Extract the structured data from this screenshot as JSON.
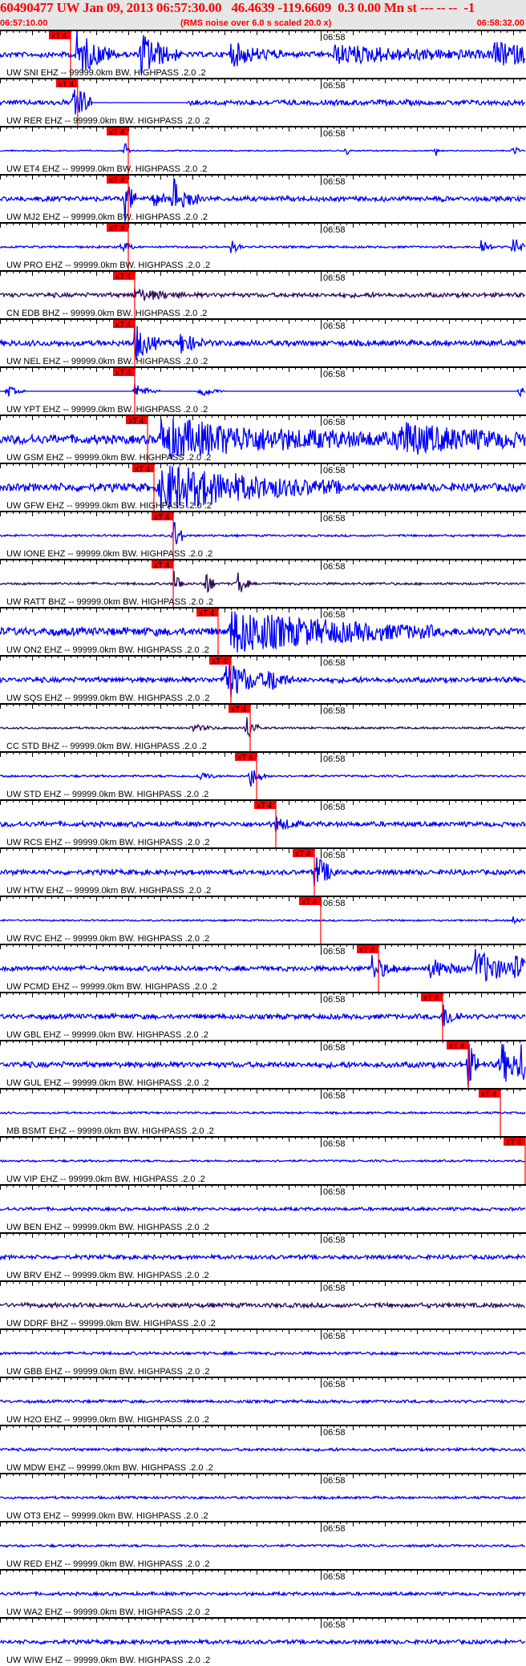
{
  "header": {
    "title": "60490477 UW Jan 09, 2013 06:57:30.00   46.4639 -119.6609  0.3 0.00 Mn st --- -- --  -1",
    "start_time": "06:57:10.00",
    "note": "(RMS noise over 6.0 s scaled 20.0 x)",
    "end_time": "06:58:32.00"
  },
  "axis": {
    "minute_label": "06:58",
    "minute_seconds": 50,
    "span_seconds": 82
  },
  "pick_label": "xT 4",
  "colors": {
    "ehz": "#0000ff",
    "bhz": "#2b0b5e",
    "pick": "#ff0000",
    "header_text": "#ff0000"
  },
  "traces": [
    {
      "label": "UW SNI EHZ -- 99999.0km BW. HIGHPASS .2.0 .2",
      "pick": 11,
      "chan": "ehz",
      "noise": 0.14,
      "bursts": [
        [
          12,
          1,
          3
        ],
        [
          22,
          1,
          3
        ],
        [
          36,
          0.5,
          4
        ],
        [
          52,
          0.35,
          15
        ],
        [
          77,
          0.4,
          8
        ]
      ]
    },
    {
      "label": "UW RER EHZ -- 99999.0km BW. HIGHPASS .2.0 .2",
      "pick": 12.1,
      "chan": "ehz",
      "noise": 0.13,
      "bursts": [
        [
          11.5,
          1,
          1.5
        ]
      ],
      "quiet": [
        14,
        29
      ]
    },
    {
      "label": "UW ET4 EHZ -- 99999.0km BW. HIGHPASS .2.0 .2",
      "pick": 20,
      "chan": "ehz",
      "noise": 0.03,
      "bursts": [
        [
          19.5,
          0.4,
          0.5
        ],
        [
          54,
          0.25,
          0.3
        ],
        [
          68,
          0.2,
          0.3
        ],
        [
          80,
          0.3,
          0.5
        ]
      ]
    },
    {
      "label": "UW MJ2 EHZ -- 99999.0km BW. HIGHPASS .2.0 .2",
      "pick": 20,
      "chan": "ehz",
      "noise": 0.12,
      "bursts": [
        [
          19.5,
          0.9,
          1
        ],
        [
          27,
          0.9,
          2
        ],
        [
          24,
          0.4,
          1
        ]
      ]
    },
    {
      "label": "UW PRO EHZ -- 99999.0km BW. HIGHPASS .2.0 .2",
      "pick": 20,
      "chan": "ehz",
      "noise": 0.05,
      "bursts": [
        [
          19,
          0.3,
          1
        ],
        [
          36,
          0.3,
          1
        ],
        [
          75,
          0.4,
          1
        ],
        [
          80,
          0.5,
          1
        ]
      ]
    },
    {
      "label": "CN EDB BHZ -- 99999.0km BW. HIGHPASS .2.0 .2",
      "pick": 21,
      "chan": "bhz",
      "noise": 0.11,
      "bursts": [
        [
          21,
          0.25,
          4
        ]
      ]
    },
    {
      "label": "UW NEL EHZ -- 99999.0km BW. HIGHPASS .2.0 .2",
      "pick": 21,
      "chan": "ehz",
      "noise": 0.14,
      "bursts": [
        [
          21,
          0.8,
          2
        ],
        [
          28,
          0.45,
          2
        ]
      ]
    },
    {
      "label": "UW YPT EHZ -- 99999.0km BW. HIGHPASS .2.0 .2",
      "pick": 21,
      "chan": "ehz",
      "noise": 0.0,
      "bursts": [
        [
          1,
          0.3,
          1.5
        ],
        [
          21,
          0.35,
          2
        ],
        [
          31,
          0.3,
          2
        ],
        [
          81,
          0.3,
          1
        ]
      ]
    },
    {
      "label": "UW GSM EHZ -- 99999.0km BW. HIGHPASS .2.0 .2",
      "pick": 23,
      "chan": "ehz",
      "noise": 0.22,
      "bursts": [
        [
          25,
          0.8,
          20
        ],
        [
          62,
          0.6,
          15
        ]
      ]
    },
    {
      "label": "UW GFW EHZ -- 99999.0km BW. HIGHPASS .2.0 .2",
      "pick": 24,
      "chan": "ehz",
      "noise": 0.2,
      "bursts": [
        [
          25,
          1,
          14
        ]
      ]
    },
    {
      "label": "UW IONE EHZ -- 99999.0km BW. HIGHPASS .2.0 .2",
      "pick": 27,
      "chan": "ehz",
      "noise": 0.05,
      "bursts": [
        [
          27,
          0.8,
          1
        ]
      ]
    },
    {
      "label": "UW RATT BHZ -- 99999.0km BW. HIGHPASS .2.0 .2",
      "pick": 27,
      "chan": "bhz",
      "noise": 0.06,
      "bursts": [
        [
          27,
          0.6,
          1
        ],
        [
          32,
          0.6,
          1
        ],
        [
          37,
          0.6,
          1
        ]
      ]
    },
    {
      "label": "UW ON2 EHZ -- 99999.0km BW. HIGHPASS .2.0 .2",
      "pick": 34,
      "chan": "ehz",
      "noise": 0.2,
      "bursts": [
        [
          36,
          0.9,
          16
        ]
      ]
    },
    {
      "label": "UW SQS EHZ -- 99999.0km BW. HIGHPASS .2.0 .2",
      "pick": 36,
      "chan": "ehz",
      "noise": 0.13,
      "bursts": [
        [
          35,
          0.9,
          4
        ],
        [
          42,
          0.45,
          2
        ]
      ]
    },
    {
      "label": "CC STD BHZ -- 99999.0km BW. HIGHPASS .2.0 .2",
      "pick": 39,
      "chan": "bhz",
      "noise": 0.05,
      "bursts": [
        [
          38.5,
          0.6,
          1
        ],
        [
          30,
          0.15,
          2
        ]
      ]
    },
    {
      "label": "UW STD EHZ -- 99999.0km BW. HIGHPASS .2.0 .2",
      "pick": 40,
      "chan": "ehz",
      "noise": 0.05,
      "bursts": [
        [
          39,
          0.5,
          1.2
        ],
        [
          31,
          0.2,
          1.5
        ]
      ]
    },
    {
      "label": "UW RCS EHZ -- 99999.0km BW. HIGHPASS .2.0 .2",
      "pick": 43,
      "chan": "ehz",
      "noise": 0.12,
      "bursts": [
        [
          43,
          0.3,
          2
        ]
      ]
    },
    {
      "label": "UW HTW EHZ -- 99999.0km BW. HIGHPASS .2.0 .2",
      "pick": 49,
      "chan": "ehz",
      "noise": 0.12,
      "bursts": [
        [
          49,
          0.75,
          2
        ]
      ]
    },
    {
      "label": "UW RVC EHZ -- 99999.0km BW. HIGHPASS .2.0 .2",
      "pick": 50,
      "chan": "ehz",
      "noise": 0.04,
      "bursts": [
        [
          80,
          0.15,
          1
        ]
      ]
    },
    {
      "label": "UW PCMD EHZ -- 99999.0km BW. HIGHPASS .2.0 .2",
      "pick": 59,
      "chan": "ehz",
      "noise": 0.12,
      "bursts": [
        [
          58,
          0.55,
          2
        ],
        [
          67,
          0.4,
          3
        ],
        [
          74,
          0.85,
          4
        ],
        [
          80,
          0.4,
          3
        ]
      ]
    },
    {
      "label": "UW GBL EHZ -- 99999.0km BW. HIGHPASS .2.0 .2",
      "pick": 69,
      "chan": "ehz",
      "noise": 0.12,
      "bursts": [
        [
          69,
          0.55,
          1.5
        ]
      ]
    },
    {
      "label": "UW GUL EHZ -- 99999.0km BW. HIGHPASS .2.0 .2",
      "pick": 73,
      "chan": "ehz",
      "noise": 0.14,
      "bursts": [
        [
          73,
          1,
          1
        ],
        [
          78,
          1,
          2
        ],
        [
          81,
          0.9,
          1
        ]
      ]
    },
    {
      "label": "MB BSMT EHZ -- 99999.0km BW. HIGHPASS .2.0 .2",
      "pick": 78,
      "chan": "ehz",
      "noise": 0.05,
      "bursts": []
    },
    {
      "label": "UW VIP EHZ -- 99999.0km BW. HIGHPASS .2.0 .2",
      "pick": 81.9,
      "chan": "ehz",
      "noise": 0.05,
      "bursts": []
    },
    {
      "label": "UW BEN EHZ -- 99999.0km BW. HIGHPASS .2.0 .2",
      "chan": "ehz",
      "noise": 0.08,
      "bursts": []
    },
    {
      "label": "UW BRV EHZ -- 99999.0km BW. HIGHPASS .2.0 .2",
      "chan": "ehz",
      "noise": 0.1,
      "bursts": []
    },
    {
      "label": "UW DDRF BHZ -- 99999.0km BW. HIGHPASS .2.0 .2",
      "chan": "bhz",
      "noise": 0.11,
      "bursts": []
    },
    {
      "label": "UW GBB EHZ -- 99999.0km BW. HIGHPASS .2.0 .2",
      "chan": "ehz",
      "noise": 0.07,
      "bursts": []
    },
    {
      "label": "UW H2O EHZ -- 99999.0km BW. HIGHPASS .2.0 .2",
      "chan": "ehz",
      "noise": 0.07,
      "bursts": []
    },
    {
      "label": "UW MDW EHZ -- 99999.0km BW. HIGHPASS .2.0 .2",
      "chan": "ehz",
      "noise": 0.07,
      "bursts": []
    },
    {
      "label": "UW OT3 EHZ -- 99999.0km BW. HIGHPASS .2.0 .2",
      "chan": "ehz",
      "noise": 0.06,
      "bursts": []
    },
    {
      "label": "UW RED EHZ -- 99999.0km BW. HIGHPASS .2.0 .2",
      "chan": "ehz",
      "noise": 0.06,
      "bursts": []
    },
    {
      "label": "UW WA2 EHZ -- 99999.0km BW. HIGHPASS .2.0 .2",
      "chan": "ehz",
      "noise": 0.08,
      "bursts": []
    },
    {
      "label": "UW WIW EHZ -- 99999.0km BW. HIGHPASS .2.0 .2",
      "chan": "ehz",
      "noise": 0.1,
      "bursts": []
    }
  ]
}
